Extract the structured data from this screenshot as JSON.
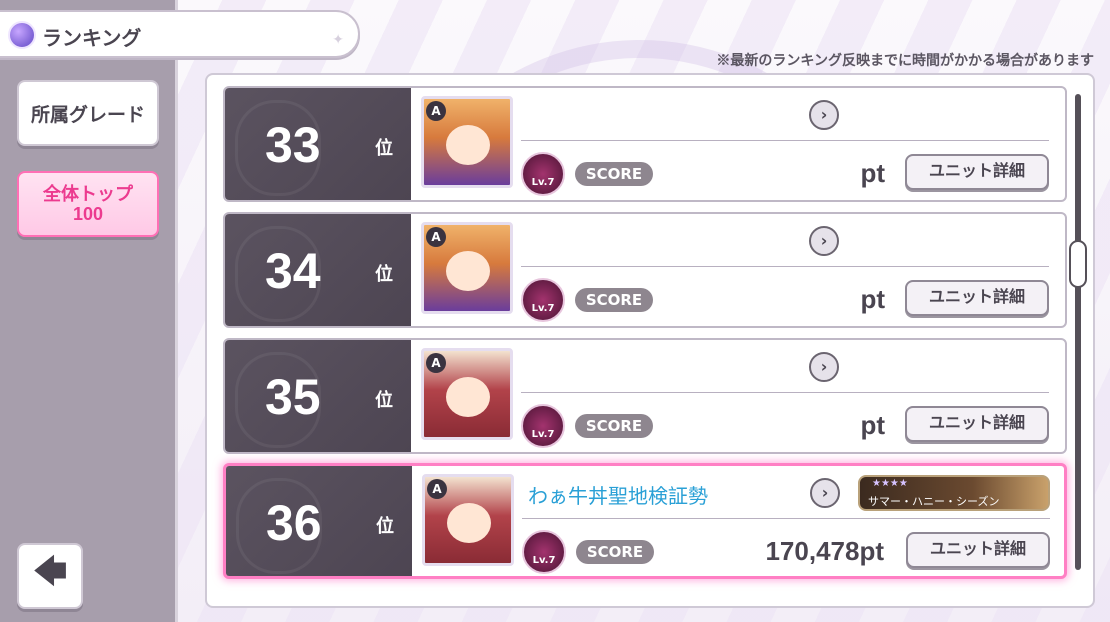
{
  "header": {
    "title": "ランキング",
    "note": "※最新のランキング反映までに時間がかかる場合があります"
  },
  "sidebar": {
    "grade_button": "所属グレード",
    "top100_line1": "全体トップ",
    "top100_line2": "100",
    "back_icon": "left-arrow-icon",
    "back_glyph": "🡄"
  },
  "rank_suffix": "位",
  "score_label": "SCORE",
  "detail_label": "ユニット詳細",
  "rows": [
    {
      "rank": "33",
      "name": "",
      "points": "pt",
      "rank_badge": "A",
      "grade_label": "Lv.7"
    },
    {
      "rank": "34",
      "name": "",
      "points": "pt",
      "rank_badge": "A",
      "grade_label": "Lv.7"
    },
    {
      "rank": "35",
      "name": "",
      "points": "pt",
      "rank_badge": "A",
      "grade_label": "Lv.7"
    },
    {
      "rank": "36",
      "name": "わぁ牛丼聖地検証勢",
      "points": "170,478pt",
      "rank_badge": "A",
      "grade_label": "Lv.7",
      "card_stars": "★★★★",
      "card_title": "サマー・ハニー・シーズン"
    }
  ],
  "colors": {
    "highlight": "#ff7fc4",
    "name_text": "#2aa0d6",
    "accent_pink": "#ec3b8f"
  }
}
